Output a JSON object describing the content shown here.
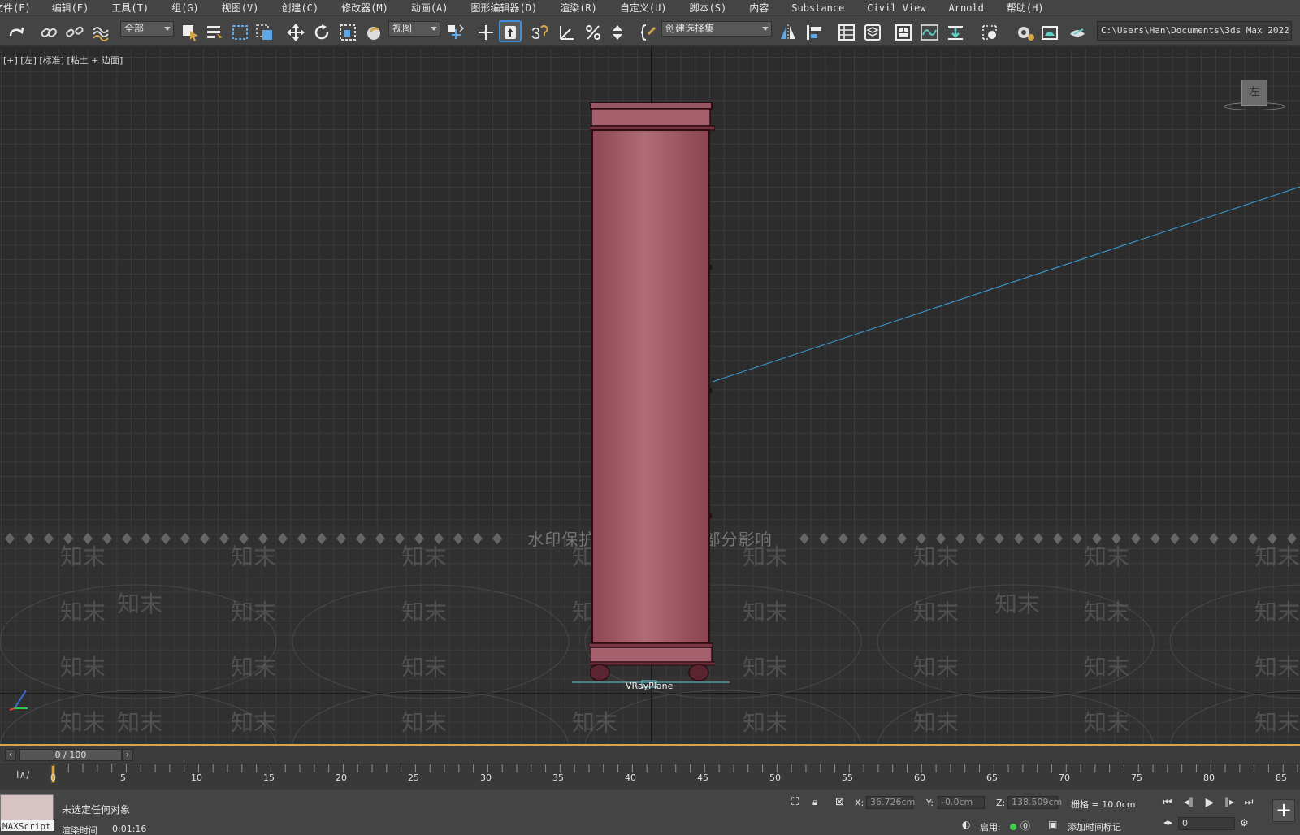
{
  "menu": [
    "文件(F)",
    "编辑(E)",
    "工具(T)",
    "组(G)",
    "视图(V)",
    "创建(C)",
    "修改器(M)",
    "动画(A)",
    "图形编辑器(D)",
    "渲染(R)",
    "自定义(U)",
    "脚本(S)",
    "内容",
    "Substance",
    "Civil View",
    "Arnold",
    "帮助(H)"
  ],
  "toolbar": {
    "filter_dropdown": "全部",
    "refcoord_dropdown": "视图",
    "selection_set_dropdown": "创建选择集",
    "snap_label": "3",
    "project_path": "C:\\Users\\Han\\Documents\\3ds Max 2022"
  },
  "viewport": {
    "label": "[+] [左] [标准] [粘土 + 边面]",
    "navcube_face": "左",
    "object_label": "VRayPlane",
    "watermark_banner": "水印保护区   画质会受到部分影响",
    "watermark_text": "知末"
  },
  "timeline": {
    "frame_display": "0 / 100",
    "ticks": [
      "0",
      "5",
      "10",
      "15",
      "20",
      "25",
      "30",
      "35",
      "40",
      "45",
      "50",
      "55",
      "60",
      "65",
      "70",
      "75",
      "80",
      "85"
    ]
  },
  "status": {
    "maxscript_label": "MAXScript 迷",
    "selection_msg": "未选定任何对象",
    "render_time_label": "渲染时间",
    "render_time_value": "0:01:16",
    "x_label": "X:",
    "x_value": "36.726cm",
    "y_label": "Y:",
    "y_value": "-0.0cm",
    "z_label": "Z:",
    "z_value": "138.509cm",
    "grid_label": "栅格 = 10.0cm",
    "enable_label": "启用:",
    "add_time_tag": "添加时间标记",
    "frame_value": "0"
  },
  "colors": {
    "cabinet": "#a35a66",
    "selection_line": "#3aa0e0",
    "accent": "#d6a74a"
  }
}
